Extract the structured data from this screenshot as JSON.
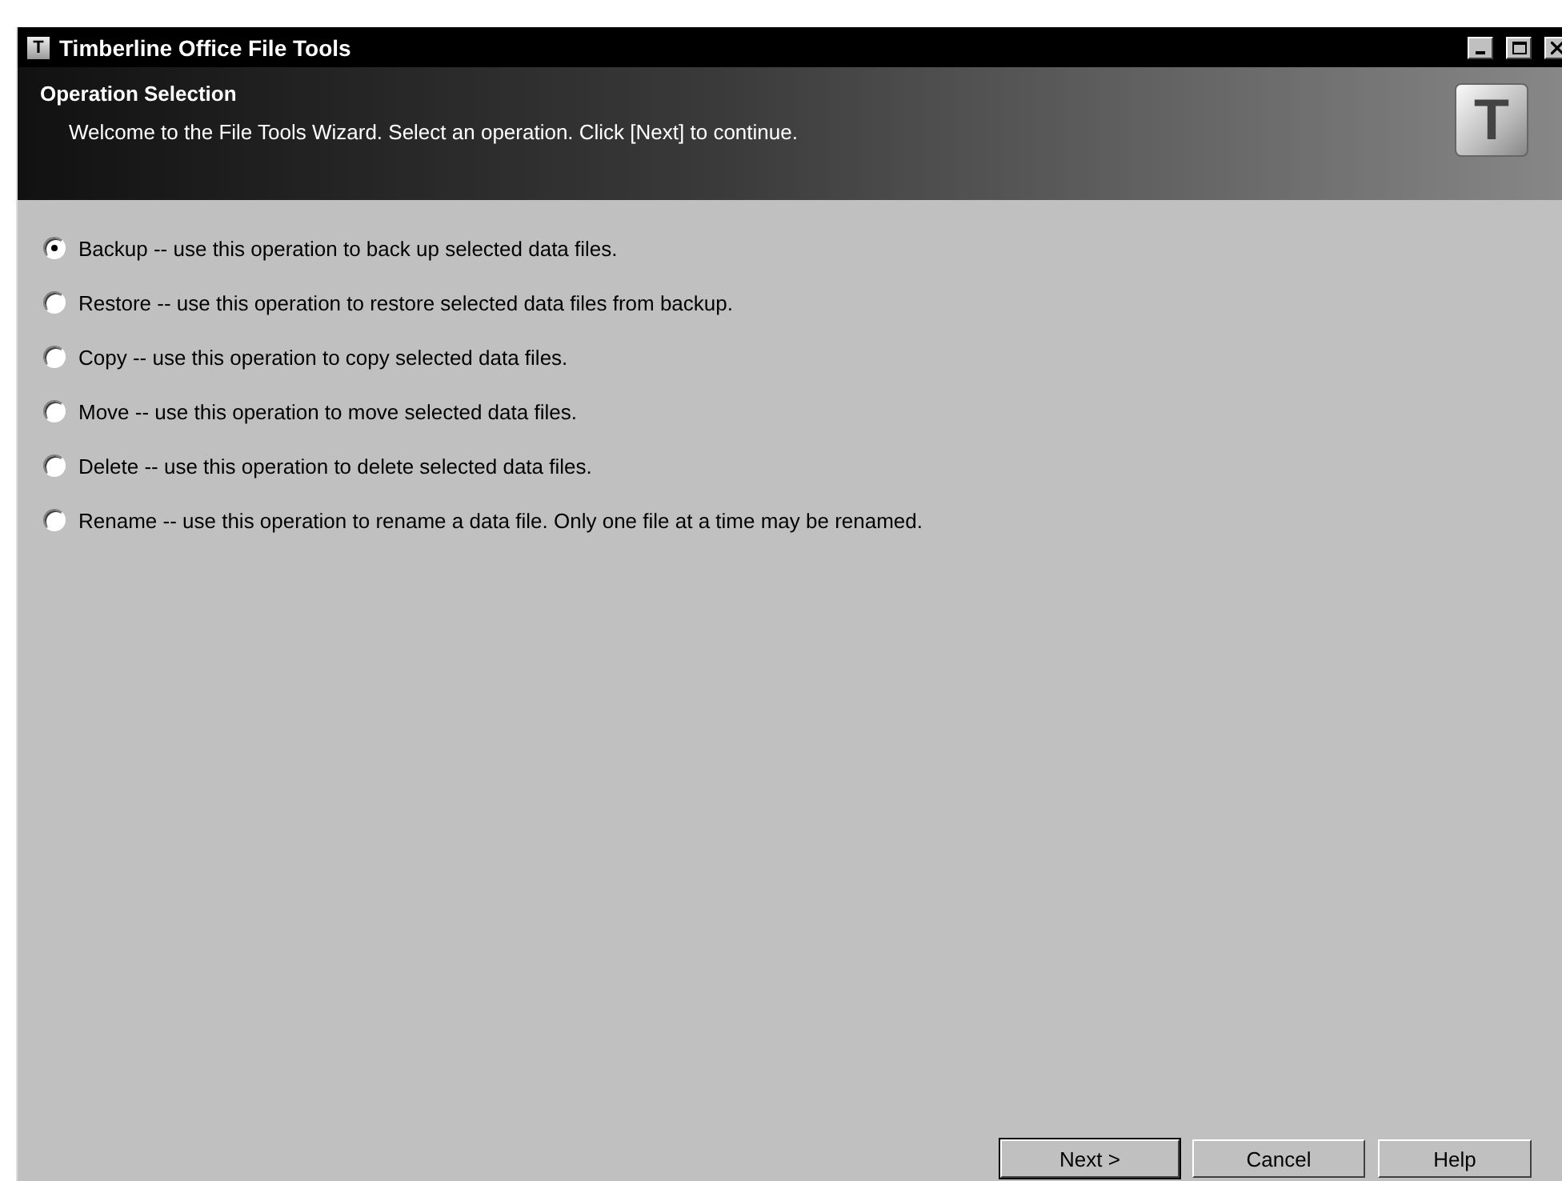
{
  "window": {
    "title": "Timberline Office File Tools",
    "icon_letter": "T"
  },
  "header": {
    "title": "Operation Selection",
    "subtitle": "Welcome to the File Tools Wizard. Select an operation. Click [Next] to continue.",
    "logo_letter": "T"
  },
  "operations": [
    {
      "label": "Backup -- use this operation to back up selected data files.",
      "selected": true
    },
    {
      "label": "Restore -- use this operation to restore selected data files from backup.",
      "selected": false
    },
    {
      "label": "Copy -- use this operation to copy selected data files.",
      "selected": false
    },
    {
      "label": "Move -- use this operation to move selected data files.",
      "selected": false
    },
    {
      "label": "Delete -- use this operation to delete selected data files.",
      "selected": false
    },
    {
      "label": "Rename -- use this operation to rename a data file.  Only one file at a time may be renamed.",
      "selected": false
    }
  ],
  "buttons": [
    {
      "label": "Next >",
      "default": true
    },
    {
      "label": "Cancel",
      "default": false
    },
    {
      "label": "Help",
      "default": false
    }
  ]
}
